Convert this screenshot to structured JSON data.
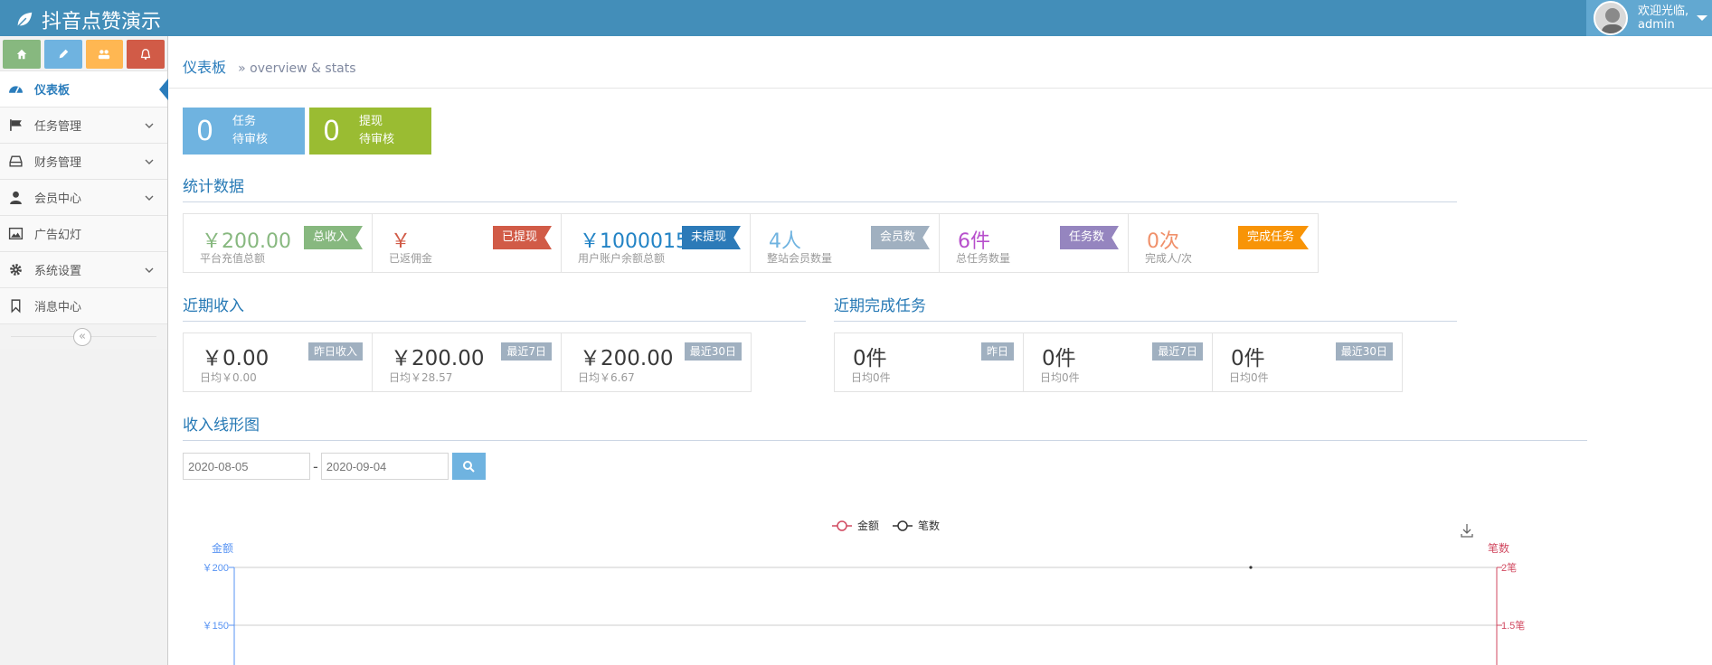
{
  "app": {
    "title": "抖音点赞演示"
  },
  "user": {
    "greeting": "欢迎光临,",
    "name": "admin"
  },
  "sidebar": {
    "items": [
      {
        "label": "仪表板",
        "icon": "dashboard-icon"
      },
      {
        "label": "任务管理",
        "icon": "flag-icon"
      },
      {
        "label": "财务管理",
        "icon": "hdd-icon"
      },
      {
        "label": "会员中心",
        "icon": "user-icon"
      },
      {
        "label": "广告幻灯",
        "icon": "picture-icon"
      },
      {
        "label": "系统设置",
        "icon": "cog-icon"
      },
      {
        "label": "消息中心",
        "icon": "bookmark-icon"
      }
    ],
    "collapse": "«"
  },
  "breadcrumb": {
    "title": "仪表板",
    "sub": "» overview & stats"
  },
  "pending": [
    {
      "num": "0",
      "line1": "任务",
      "line2": "待审核",
      "color": "#6fb3e0"
    },
    {
      "num": "0",
      "line1": "提现",
      "line2": "待审核",
      "color": "#9abc32"
    }
  ],
  "sections": {
    "stats": "统计数据",
    "income": "近期收入",
    "tasks": "近期完成任务",
    "chart": "收入线形图"
  },
  "stats": [
    {
      "value": "￥200.00",
      "caption": "平台充值总额",
      "tag": "总收入",
      "value_color": "#87b87f",
      "tag_color": "#87b87f"
    },
    {
      "value": "￥",
      "caption": "已返佣金",
      "tag": "已提现",
      "value_color": "#d15b47",
      "tag_color": "#d15b47"
    },
    {
      "value": "￥1000015",
      "caption": "用户账户余额总额",
      "tag": "未提现",
      "value_color": "#2283c5",
      "tag_color": "#2c7ab8"
    },
    {
      "value": "4人",
      "caption": "整站会员数量",
      "tag": "会员数",
      "value_color": "#6fb3e0",
      "tag_color": "#a0b0c0"
    },
    {
      "value": "6件",
      "caption": "总任务数量",
      "tag": "任务数",
      "value_color": "#b74fcc",
      "tag_color": "#9585bf"
    },
    {
      "value": "0次",
      "caption": "完成人/次",
      "tag": "完成任务",
      "value_color": "#f0906a",
      "tag_color": "#f89406"
    }
  ],
  "income": [
    {
      "value": "￥0.00",
      "caption": "日均￥0.00",
      "tag": "昨日收入"
    },
    {
      "value": "￥200.00",
      "caption": "日均￥28.57",
      "tag": "最近7日"
    },
    {
      "value": "￥200.00",
      "caption": "日均￥6.67",
      "tag": "最近30日"
    }
  ],
  "tasks": [
    {
      "value": "0件",
      "caption": "日均0件",
      "tag": "昨日"
    },
    {
      "value": "0件",
      "caption": "日均0件",
      "tag": "最近7日"
    },
    {
      "value": "0件",
      "caption": "日均0件",
      "tag": "最近30日"
    }
  ],
  "date_range": {
    "start": "2020-08-05",
    "end": "2020-09-04",
    "dash": "-"
  },
  "chart_data": {
    "type": "line",
    "series": [
      {
        "name": "金额",
        "color": "#d14a61",
        "values": []
      },
      {
        "name": "笔数",
        "color": "#333333",
        "values": []
      }
    ],
    "ylabel": "金额",
    "y2label": "笔数",
    "y_ticks": [
      "￥200",
      "￥150"
    ],
    "y2_ticks": [
      "2笔",
      "1.5笔"
    ],
    "ylim": [
      0,
      200
    ],
    "y2lim": [
      0,
      2
    ],
    "grid": true,
    "legend": "top-center",
    "point": {
      "y": 200
    }
  },
  "colors": {
    "topbar": "#438eb9",
    "accent": "#2b7dbc",
    "axis_left": "#5793f3",
    "axis_right": "#d14a61"
  }
}
